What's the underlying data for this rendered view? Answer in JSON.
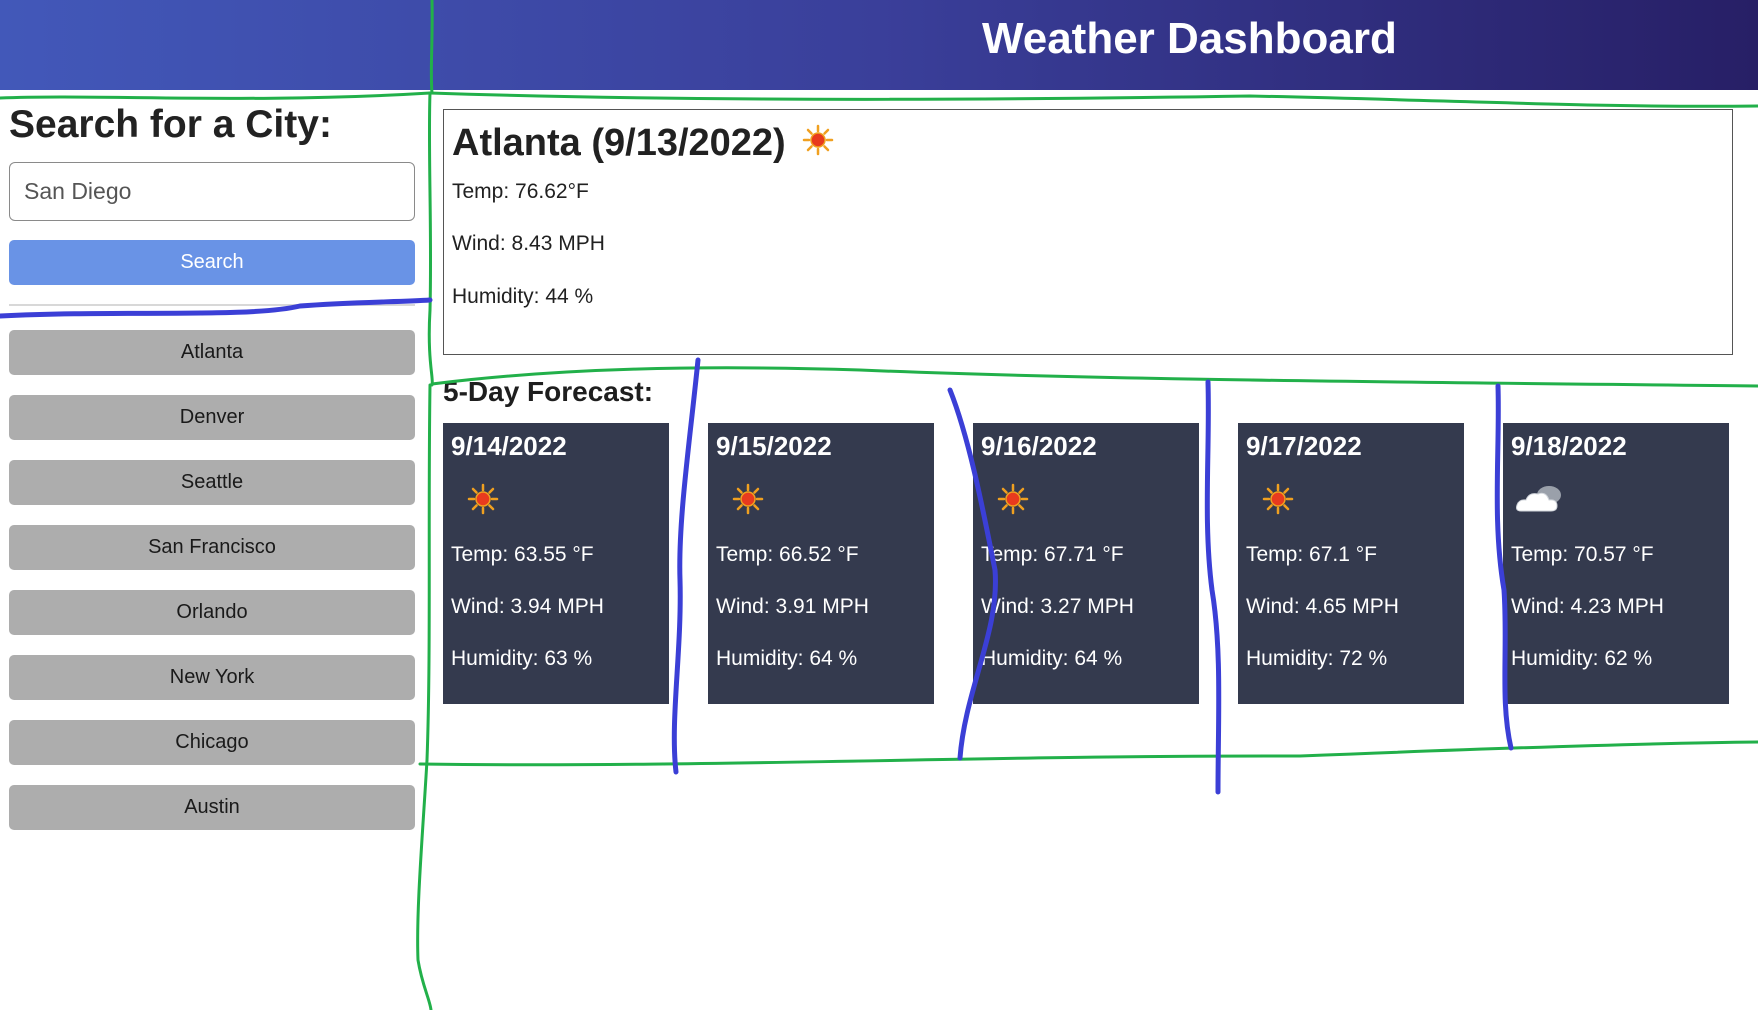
{
  "header": {
    "title": "Weather Dashboard"
  },
  "sidebar": {
    "heading": "Search for a City:",
    "search_value": "San Diego",
    "search_button": "Search",
    "history": [
      {
        "label": "Atlanta"
      },
      {
        "label": "Denver"
      },
      {
        "label": "Seattle"
      },
      {
        "label": "San Francisco"
      },
      {
        "label": "Orlando"
      },
      {
        "label": "New York"
      },
      {
        "label": "Chicago"
      },
      {
        "label": "Austin"
      }
    ]
  },
  "current": {
    "title": "Atlanta (9/13/2022)",
    "icon": "sun-icon",
    "temp": "Temp: 76.62°F",
    "wind": "Wind: 8.43 MPH",
    "humidity": "Humidity: 44 %"
  },
  "forecast": {
    "heading": "5-Day Forecast:",
    "days": [
      {
        "date": "9/14/2022",
        "icon": "sun-icon",
        "temp": "Temp: 63.55 °F",
        "wind": "Wind: 3.94 MPH",
        "humidity": "Humidity: 63 %"
      },
      {
        "date": "9/15/2022",
        "icon": "sun-icon",
        "temp": "Temp: 66.52 °F",
        "wind": "Wind: 3.91 MPH",
        "humidity": "Humidity: 64 %"
      },
      {
        "date": "9/16/2022",
        "icon": "sun-icon",
        "temp": "Temp: 67.71 °F",
        "wind": "Wind: 3.27 MPH",
        "humidity": "Humidity: 64 %"
      },
      {
        "date": "9/17/2022",
        "icon": "sun-icon",
        "temp": "Temp: 67.1 °F",
        "wind": "Wind: 4.65 MPH",
        "humidity": "Humidity: 72 %"
      },
      {
        "date": "9/18/2022",
        "icon": "cloud-icon",
        "temp": "Temp: 70.57 °F",
        "wind": "Wind: 4.23 MPH",
        "humidity": "Humidity: 62 %"
      }
    ]
  },
  "colors": {
    "header_start": "#4258b9",
    "header_end": "#271f66",
    "search_button": "#6993e6",
    "history_button": "#adadad",
    "forecast_card": "#343a4e",
    "annotation_green": "#22b04a",
    "annotation_blue": "#3b3fd6"
  }
}
